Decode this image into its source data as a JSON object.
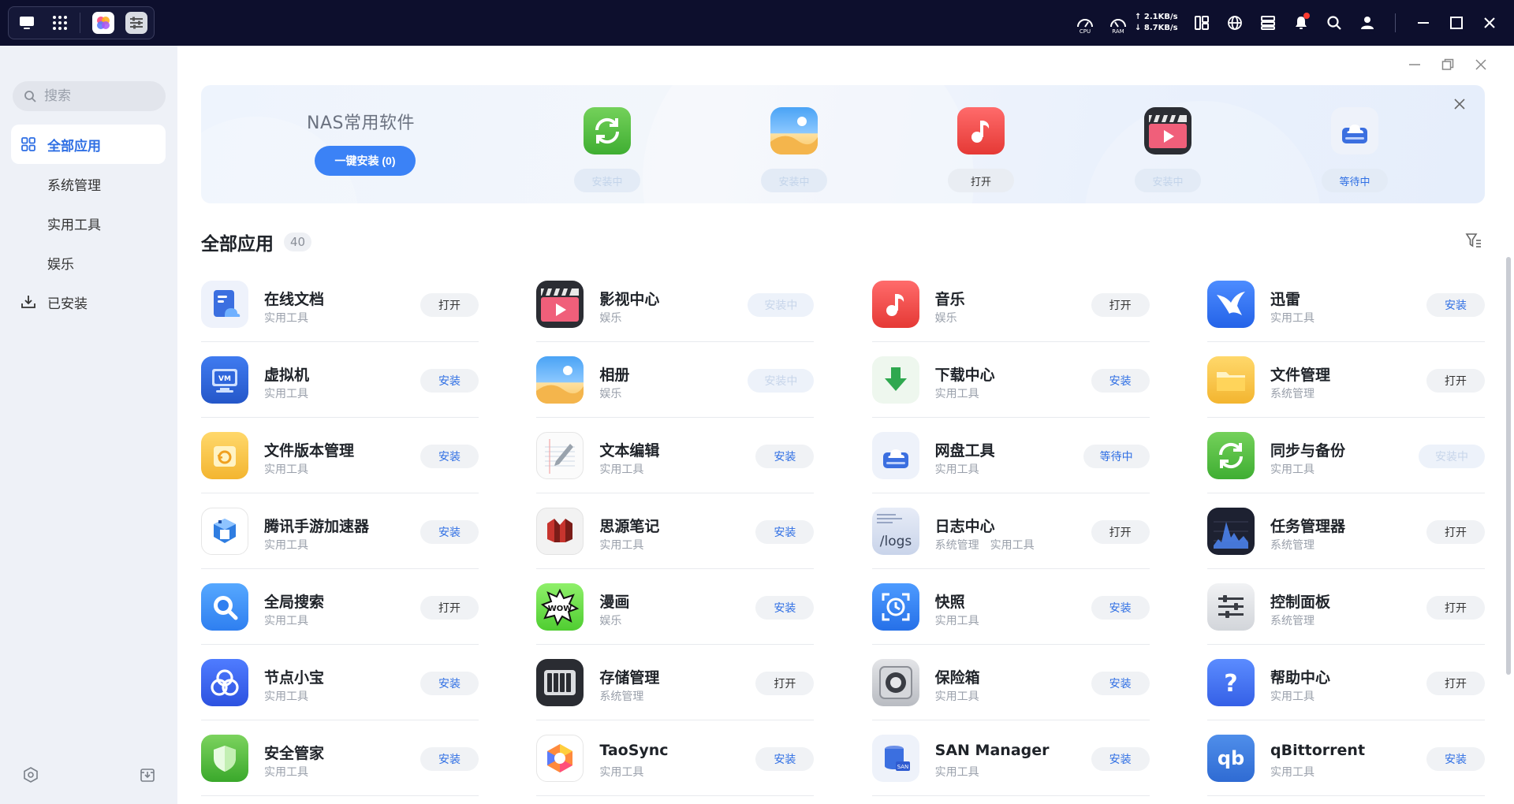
{
  "topbar": {
    "cpu_label": "CPU",
    "ram_label": "RAM",
    "upload": "2.1KB/s",
    "download": "8.7KB/s",
    "upload_arrow": "↑",
    "download_arrow": "↓"
  },
  "sidebar": {
    "search_placeholder": "搜索",
    "items": [
      {
        "label": "全部应用"
      },
      {
        "label": "系统管理"
      },
      {
        "label": "实用工具"
      },
      {
        "label": "娱乐"
      },
      {
        "label": "已安装"
      }
    ]
  },
  "banner": {
    "title": "NAS常用软件",
    "install_all": "一键安装 (0)",
    "apps": [
      {
        "icon": "sync-backup-icon",
        "status": "安装中"
      },
      {
        "icon": "photos-icon",
        "status": "安装中"
      },
      {
        "icon": "music-icon",
        "status": "打开"
      },
      {
        "icon": "video-center-icon",
        "status": "安装中"
      },
      {
        "icon": "cloud-drive-icon",
        "status": "等待中"
      }
    ]
  },
  "section": {
    "title": "全部应用",
    "count": "40"
  },
  "apps": [
    {
      "name": "在线文档",
      "cat": "实用工具",
      "action": "打开",
      "state": "open",
      "icon": "online-docs-icon"
    },
    {
      "name": "影视中心",
      "cat": "娱乐",
      "action": "安装中",
      "state": "installing",
      "icon": "video-center-icon"
    },
    {
      "name": "音乐",
      "cat": "娱乐",
      "action": "打开",
      "state": "open",
      "icon": "music-icon"
    },
    {
      "name": "迅雷",
      "cat": "实用工具",
      "action": "安装",
      "state": "install",
      "icon": "thunder-icon"
    },
    {
      "name": "虚拟机",
      "cat": "实用工具",
      "action": "安装",
      "state": "install",
      "icon": "vm-icon"
    },
    {
      "name": "相册",
      "cat": "娱乐",
      "action": "安装中",
      "state": "installing",
      "icon": "photos-icon"
    },
    {
      "name": "下载中心",
      "cat": "实用工具",
      "action": "安装",
      "state": "install",
      "icon": "download-icon"
    },
    {
      "name": "文件管理",
      "cat": "系统管理",
      "action": "打开",
      "state": "open",
      "icon": "folder-icon"
    },
    {
      "name": "文件版本管理",
      "cat": "实用工具",
      "action": "安装",
      "state": "install",
      "icon": "file-version-icon"
    },
    {
      "name": "文本编辑",
      "cat": "实用工具",
      "action": "安装",
      "state": "install",
      "icon": "text-editor-icon"
    },
    {
      "name": "网盘工具",
      "cat": "实用工具",
      "action": "等待中",
      "state": "waiting",
      "icon": "cloud-drive-icon"
    },
    {
      "name": "同步与备份",
      "cat": "实用工具",
      "action": "安装中",
      "state": "installing",
      "icon": "sync-backup-icon"
    },
    {
      "name": "腾讯手游加速器",
      "cat": "实用工具",
      "action": "安装",
      "state": "install",
      "icon": "game-accelerator-icon"
    },
    {
      "name": "思源笔记",
      "cat": "实用工具",
      "action": "安装",
      "state": "install",
      "icon": "siyuan-notes-icon"
    },
    {
      "name": "日志中心",
      "cat": "系统管理　实用工具",
      "action": "打开",
      "state": "open",
      "icon": "logs-icon"
    },
    {
      "name": "任务管理器",
      "cat": "系统管理",
      "action": "打开",
      "state": "open",
      "icon": "task-manager-icon"
    },
    {
      "name": "全局搜索",
      "cat": "实用工具",
      "action": "打开",
      "state": "open",
      "icon": "global-search-icon"
    },
    {
      "name": "漫画",
      "cat": "娱乐",
      "action": "安装",
      "state": "install",
      "icon": "comics-icon"
    },
    {
      "name": "快照",
      "cat": "实用工具",
      "action": "安装",
      "state": "install",
      "icon": "snapshot-icon"
    },
    {
      "name": "控制面板",
      "cat": "系统管理",
      "action": "打开",
      "state": "open",
      "icon": "control-panel-icon"
    },
    {
      "name": "节点小宝",
      "cat": "实用工具",
      "action": "安装",
      "state": "install",
      "icon": "node-icon"
    },
    {
      "name": "存储管理",
      "cat": "系统管理",
      "action": "打开",
      "state": "open",
      "icon": "storage-icon"
    },
    {
      "name": "保险箱",
      "cat": "实用工具",
      "action": "安装",
      "state": "install",
      "icon": "safe-icon"
    },
    {
      "name": "帮助中心",
      "cat": "实用工具",
      "action": "打开",
      "state": "open",
      "icon": "help-icon"
    },
    {
      "name": "安全管家",
      "cat": "实用工具",
      "action": "安装",
      "state": "install",
      "icon": "security-shield-icon"
    },
    {
      "name": "TaoSync",
      "cat": "实用工具",
      "action": "安装",
      "state": "install",
      "icon": "taosync-icon"
    },
    {
      "name": "SAN Manager",
      "cat": "实用工具",
      "action": "安装",
      "state": "install",
      "icon": "san-manager-icon"
    },
    {
      "name": "qBittorrent",
      "cat": "实用工具",
      "action": "安装",
      "state": "install",
      "icon": "qbittorrent-icon"
    }
  ]
}
